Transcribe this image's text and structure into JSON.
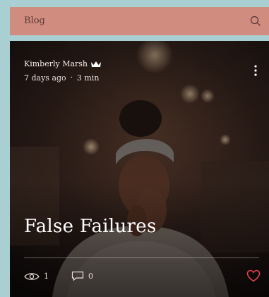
{
  "header": {
    "title": "Blog",
    "search_icon": "search-icon"
  },
  "post": {
    "author": "Kimberly Marsh",
    "author_badge_icon": "crown-icon",
    "age": "7 days ago",
    "read_time": "3 min",
    "title": "False Failures",
    "views": "1",
    "comments": "0",
    "menu_icon": "more-vertical-icon",
    "like_icon": "heart-icon"
  },
  "colors": {
    "page_bg": "#a9cfd2",
    "header_bg": "#cf8c7f",
    "heart": "#e0404f"
  }
}
